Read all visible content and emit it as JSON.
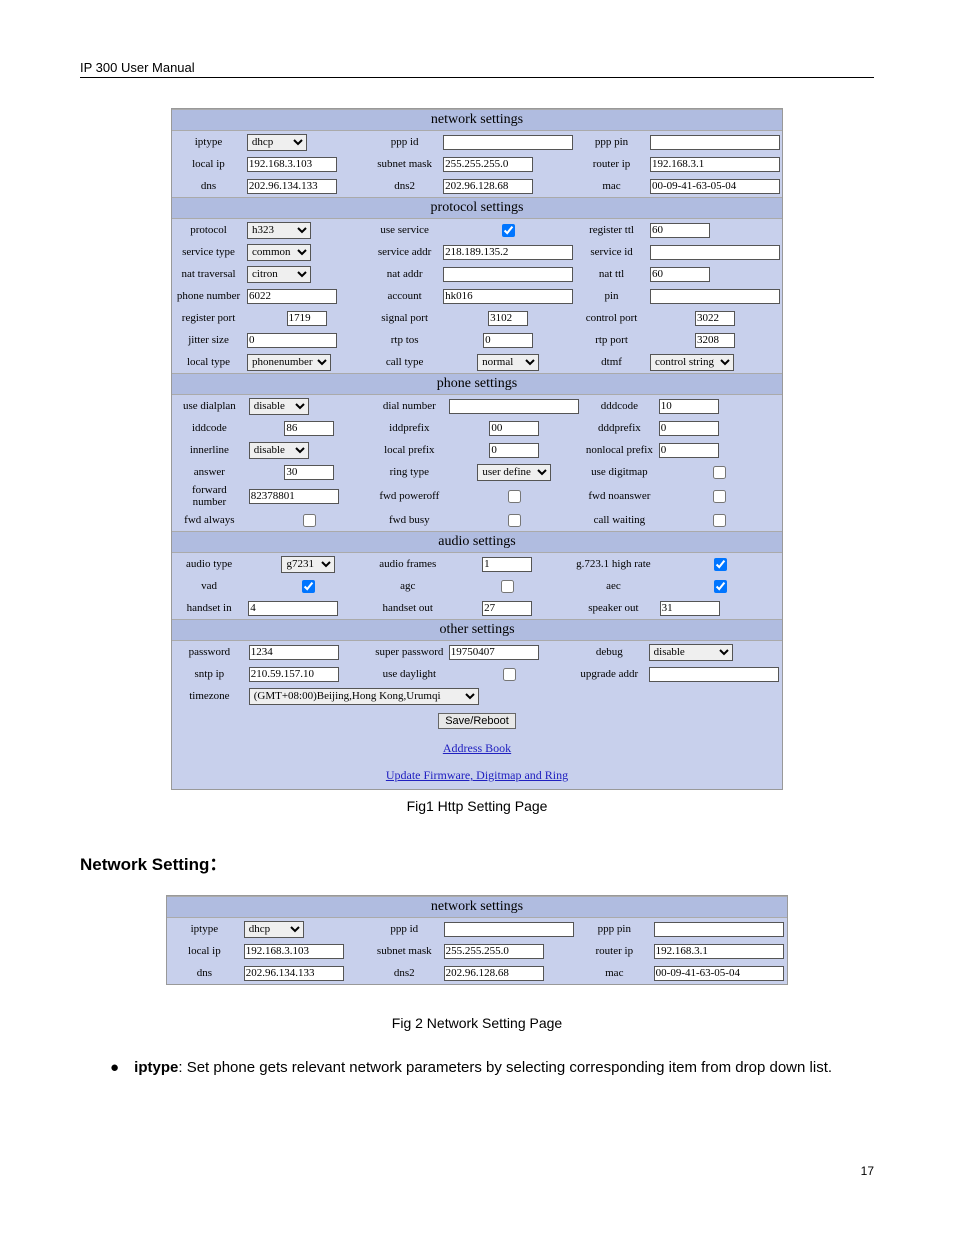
{
  "doc_header": "IP 300 User Manual",
  "page_number": "17",
  "fig1_caption": "Fig1 Http Setting Page",
  "fig2_caption": "Fig 2 Network Setting Page",
  "section_title": "Network Setting：",
  "bullet_label": "iptype",
  "bullet_text": ": Set phone gets relevant network parameters by selecting corresponding item from drop down list.",
  "headers": {
    "network": "network settings",
    "protocol": "protocol settings",
    "phone": "phone settings",
    "audio": "audio settings",
    "other": "other settings"
  },
  "labels": {
    "iptype": "iptype",
    "ppp_id": "ppp id",
    "ppp_pin": "ppp pin",
    "local_ip": "local ip",
    "subnet_mask": "subnet mask",
    "router_ip": "router ip",
    "dns": "dns",
    "dns2": "dns2",
    "mac": "mac",
    "protocol": "protocol",
    "use_service": "use service",
    "register_ttl": "register ttl",
    "service_type": "service type",
    "service_addr": "service addr",
    "service_id": "service id",
    "nat_traversal": "nat traversal",
    "nat_addr": "nat addr",
    "nat_ttl": "nat ttl",
    "phone_number": "phone number",
    "account": "account",
    "pin": "pin",
    "register_port": "register port",
    "signal_port": "signal port",
    "control_port": "control port",
    "jitter_size": "jitter size",
    "rtp_tos": "rtp tos",
    "rtp_port": "rtp port",
    "local_type": "local type",
    "call_type": "call type",
    "dtmf": "dtmf",
    "use_dialplan": "use dialplan",
    "dial_number": "dial number",
    "dddcode": "dddcode",
    "iddcode": "iddcode",
    "iddprefix": "iddprefix",
    "dddprefix": "dddprefix",
    "innerline": "innerline",
    "local_prefix": "local prefix",
    "nonlocal_prefix": "nonlocal prefix",
    "answer": "answer",
    "ring_type": "ring type",
    "use_digitmap": "use digitmap",
    "forward_number": "forward number",
    "fwd_poweroff": "fwd poweroff",
    "fwd_noanswer": "fwd noanswer",
    "fwd_always": "fwd always",
    "fwd_busy": "fwd busy",
    "call_waiting": "call waiting",
    "audio_type": "audio type",
    "audio_frames": "audio frames",
    "g7231": "g.723.1 high rate",
    "vad": "vad",
    "agc": "agc",
    "aec": "aec",
    "handset_in": "handset in",
    "handset_out": "handset out",
    "speaker_out": "speaker out",
    "password": "password",
    "super_password": "super password",
    "debug": "debug",
    "sntp_ip": "sntp ip",
    "use_daylight": "use daylight",
    "upgrade_addr": "upgrade addr",
    "timezone": "timezone"
  },
  "values": {
    "iptype": "dhcp",
    "ppp_id": "",
    "ppp_pin": "",
    "local_ip": "192.168.3.103",
    "subnet_mask": "255.255.255.0",
    "router_ip": "192.168.3.1",
    "dns": "202.96.134.133",
    "dns2": "202.96.128.68",
    "mac": "00-09-41-63-05-04",
    "protocol": "h323",
    "use_service_chk": true,
    "register_ttl": "60",
    "service_type": "common",
    "service_addr": "218.189.135.2",
    "service_id": "",
    "nat_traversal": "citron",
    "nat_addr": "",
    "nat_ttl": "60",
    "phone_number": "6022",
    "account": "hk016",
    "pin": "",
    "register_port": "1719",
    "signal_port": "3102",
    "control_port": "3022",
    "jitter_size": "0",
    "rtp_tos": "0",
    "rtp_port": "3208",
    "local_type": "phonenumber",
    "call_type": "normal",
    "dtmf": "control string",
    "use_dialplan": "disable",
    "dial_number": "",
    "dddcode": "10",
    "iddcode": "86",
    "iddprefix": "00",
    "dddprefix": "0",
    "innerline": "disable",
    "local_prefix": "0",
    "nonlocal_prefix": "0",
    "answer": "30",
    "ring_type": "user define",
    "use_digitmap_chk": false,
    "forward_number": "82378801",
    "fwd_poweroff_chk": false,
    "fwd_noanswer_chk": false,
    "fwd_always_chk": false,
    "fwd_busy_chk": false,
    "call_waiting_chk": false,
    "audio_type": "g7231",
    "audio_frames": "1",
    "g7231_chk": true,
    "vad_chk": true,
    "agc_chk": false,
    "aec_chk": true,
    "handset_in": "4",
    "handset_out": "27",
    "speaker_out": "31",
    "password": "1234",
    "super_password": "19750407",
    "debug": "disable",
    "sntp_ip": "210.59.157.10",
    "use_daylight_chk": false,
    "upgrade_addr": "",
    "timezone": "(GMT+08:00)Beijing,Hong Kong,Urumqi"
  },
  "buttons": {
    "save": "Save/Reboot"
  },
  "links": {
    "address_book": "Address Book",
    "update": "Update Firmware, Digitmap and Ring"
  }
}
